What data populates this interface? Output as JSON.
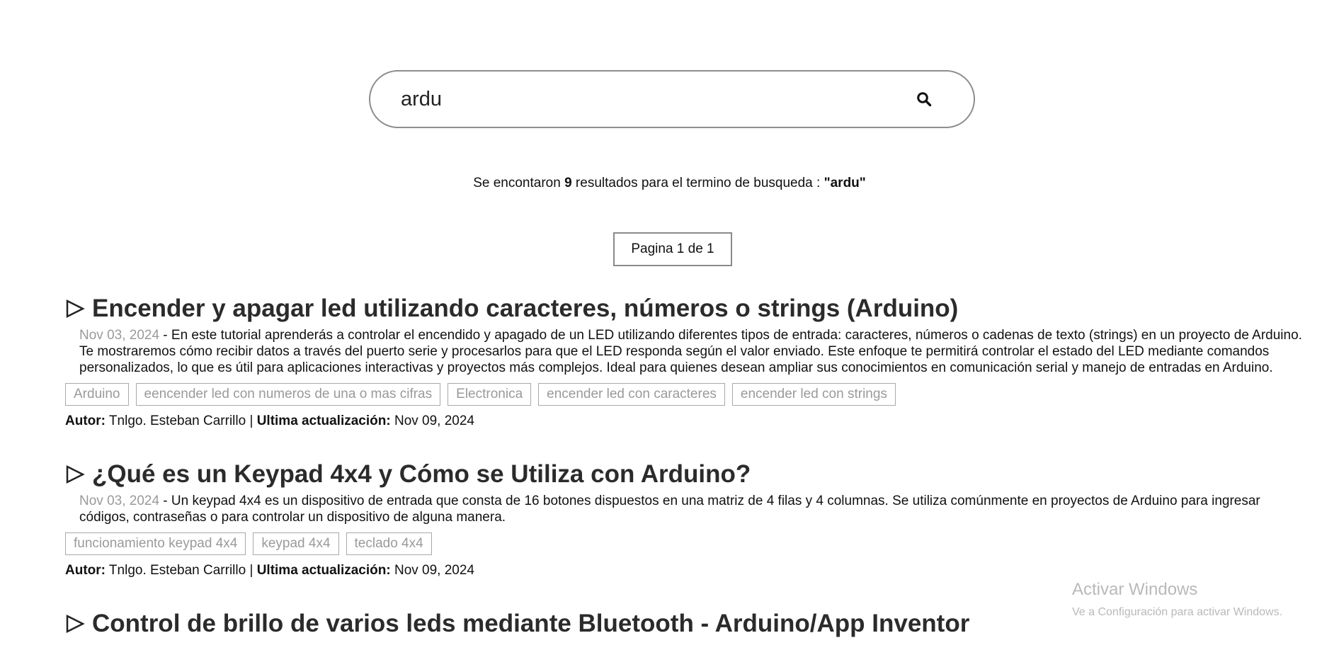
{
  "search": {
    "query": "ardu",
    "icon": "search-icon"
  },
  "summary": {
    "prefix": "Se encontaron ",
    "count": "9",
    "middle": " resultados para el termino de busqueda : ",
    "term": "\"ardu\""
  },
  "pagination": {
    "label": "Pagina 1 de 1"
  },
  "labels": {
    "author": "Autor:",
    "separator": " | ",
    "updated": "Ultima actualización:"
  },
  "articles": [
    {
      "title": "Encender y apagar led utilizando caracteres, números o strings (Arduino)",
      "date": "Nov 03, 2024",
      "excerpt": " - En este tutorial aprenderás a controlar el encendido y apagado de un LED utilizando diferentes tipos de entrada: caracteres, números o cadenas de texto (strings) en un proyecto de Arduino. Te mostraremos cómo recibir datos a través del puerto serie y procesarlos para que el LED responda según el valor enviado. Este enfoque te permitirá controlar el estado del LED mediante comandos personalizados, lo que es útil para aplicaciones interactivas y proyectos más complejos. Ideal para quienes desean ampliar sus conocimientos en comunicación serial y manejo de entradas en Arduino.",
      "tags": [
        "Arduino",
        "eencender led con numeros de una o mas cifras",
        "Electronica",
        "encender led con caracteres",
        "encender led con strings"
      ],
      "author": "Tnlgo. Esteban Carrillo",
      "updated": "Nov 09, 2024"
    },
    {
      "title": "¿Qué es un Keypad 4x4 y Cómo se Utiliza con Arduino?",
      "date": "Nov 03, 2024",
      "excerpt": " - Un keypad 4x4 es un dispositivo de entrada que consta de 16 botones dispuestos en una matriz de 4 filas y 4 columnas. Se utiliza comúnmente en proyectos de Arduino para ingresar códigos, contraseñas o para controlar un dispositivo de alguna manera.",
      "tags": [
        "funcionamiento keypad 4x4",
        "keypad 4x4",
        "teclado 4x4"
      ],
      "author": "Tnlgo. Esteban Carrillo",
      "updated": "Nov 09, 2024"
    },
    {
      "title": "Control de brillo de varios leds mediante Bluetooth - Arduino/App Inventor"
    }
  ],
  "watermark": {
    "title": "Activar Windows",
    "subtitle": "Ve a Configuración para activar Windows."
  }
}
